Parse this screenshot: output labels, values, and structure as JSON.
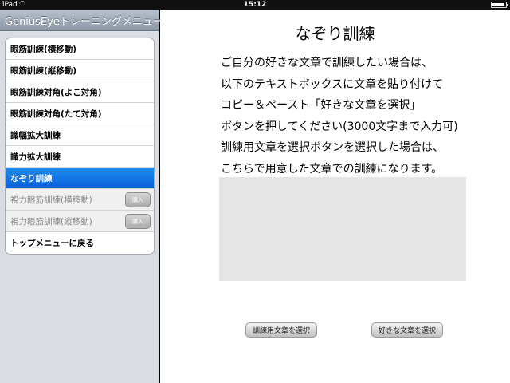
{
  "statusbar": {
    "carrier": "iPad",
    "wifi_icon": "wifi-icon",
    "time": "15:12",
    "battery_level": 0.9
  },
  "sidebar": {
    "title": "GeniusEyeトレーニングメニュー",
    "items": [
      {
        "label": "眼筋訓練(横移動)"
      },
      {
        "label": "眼筋訓練(縦移動)"
      },
      {
        "label": "眼筋訓練対角(よこ対角)"
      },
      {
        "label": "眼筋訓練対角(たて対角)"
      },
      {
        "label": "識幅拡大訓練"
      },
      {
        "label": "識力拡大訓練"
      },
      {
        "label": "なぞり訓練"
      },
      {
        "label": "視力眼筋訓練(横移動)",
        "buy_label": "購入"
      },
      {
        "label": "視力眼筋訓練(縦移動)",
        "buy_label": "購入"
      },
      {
        "label": "トップメニューに戻る"
      }
    ]
  },
  "main": {
    "title": "なぞり訓練",
    "instructions": [
      "ご自分の好きな文章で訓練したい場合は、",
      "以下のテキストボックスに文章を貼り付けて",
      "コピー＆ペースト「好きな文章を選択」",
      "ボタンを押してください(3000文字まで入力可)",
      "訓練用文章を選択ボタンを選択した場合は、",
      "こちらで用意した文章での訓練になります。"
    ],
    "text_value": "",
    "select_training_label": "訓練用文章を選択",
    "select_favorite_label": "好きな文章を選択"
  }
}
